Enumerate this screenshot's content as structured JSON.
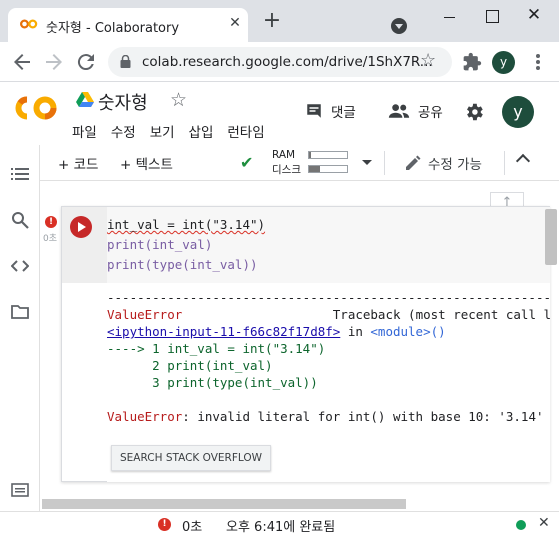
{
  "browser": {
    "tab_title": "숫자형 - Colaboratory",
    "tab_close": "✕",
    "new_tab": "+",
    "url": "colab.research.google.com/drive/1ShX7R...",
    "profile_initial": "y",
    "window_close": "✕"
  },
  "colab": {
    "doc_title": "숫자형",
    "menu": [
      "파일",
      "수정",
      "보기",
      "삽입",
      "런타임"
    ],
    "comment_label": "댓글",
    "share_label": "공유",
    "avatar_initial": "y"
  },
  "toolbar": {
    "add_code": "+ 코드",
    "add_text": "+ 텍스트",
    "ram_label": "RAM",
    "disk_label": "디스크",
    "ram_usage": 0.05,
    "disk_usage": 0.3,
    "edit_mode": "수정 가능"
  },
  "cell": {
    "exec_time": "0초",
    "code_lines": [
      "int_val = int(\"3.14\")",
      "print(int_val)",
      "print(type(int_val))"
    ],
    "output": {
      "separator": "---------------------------------------------------------------------------",
      "error_name": "ValueError",
      "traceback_header": "Traceback (most recent call last)",
      "input_link": "<ipython-input-11-f66c82f17d8f>",
      "in_text": " in ",
      "module_text": "<module>",
      "module_parens": "()",
      "arrow_line": "----> 1 int_val = int(\"3.14\")",
      "line2": "      2 print(int_val)",
      "line3": "      3 print(type(int_val))",
      "error_label": "ValueError",
      "error_message": ": invalid literal for int() with base 10: '3.14'"
    },
    "search_button": "SEARCH STACK OVERFLOW"
  },
  "status": {
    "exec_time": "0초",
    "completion": "오후 6:41에 완료됨"
  },
  "colors": {
    "accent_orange": "#f9ab00",
    "run_red": "#c62828",
    "success_green": "#0f9d58",
    "error_red": "#d93025"
  }
}
